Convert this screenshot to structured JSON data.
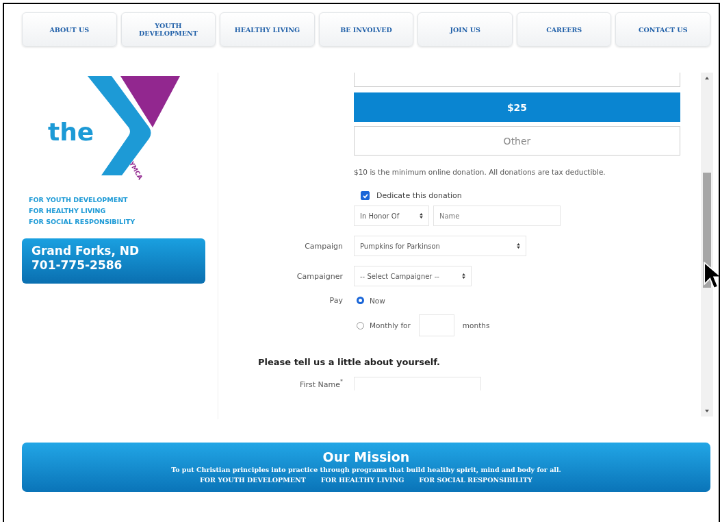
{
  "nav": [
    {
      "label": "ABOUT US"
    },
    {
      "label": "YOUTH DEVELOPMENT"
    },
    {
      "label": "HEALTHY LIVING"
    },
    {
      "label": "BE INVOLVED"
    },
    {
      "label": "JOIN US"
    },
    {
      "label": "CAREERS"
    },
    {
      "label": "CONTACT US"
    }
  ],
  "logo": {
    "word": "the",
    "mark": "YMCA"
  },
  "taglines": [
    "FOR YOUTH DEVELOPMENT",
    "FOR HEALTHY LIVING",
    "FOR SOCIAL RESPONSIBILITY"
  ],
  "location": {
    "city": "Grand Forks, ND",
    "phone": "701-775-2586"
  },
  "form": {
    "amounts": [
      {
        "label": "$25",
        "selected": true
      },
      {
        "label": "Other",
        "selected": false
      }
    ],
    "note": "$10 is the minimum online donation. All donations are tax deductible.",
    "dedicate": {
      "label": "Dedicate this donation",
      "checked": true
    },
    "honor": {
      "value": "In Honor Of",
      "placeholder": "Name"
    },
    "selects": [
      {
        "label": "Campaign",
        "value": "Pumpkins for Parkinson"
      },
      {
        "label": "Campaigner",
        "value": "-- Select Campaigner --"
      }
    ],
    "pay": {
      "label": "Pay",
      "options": [
        {
          "label": "Now",
          "selected": true,
          "kind": "plain"
        },
        {
          "label": "Monthly for",
          "selected": false,
          "kind": "months",
          "suffix": "months"
        }
      ]
    },
    "heading": "Please tell us a little about yourself.",
    "first_name": {
      "label": "First Name",
      "mark": "*"
    }
  },
  "mission": {
    "title": "Our Mission",
    "text": "To put Christian principles into practice through programs that build healthy spirit, mind and body for all.",
    "pillars": [
      "FOR YOUTH DEVELOPMENT",
      "FOR HEALTHY LIVING",
      "FOR SOCIAL RESPONSIBILITY"
    ]
  }
}
